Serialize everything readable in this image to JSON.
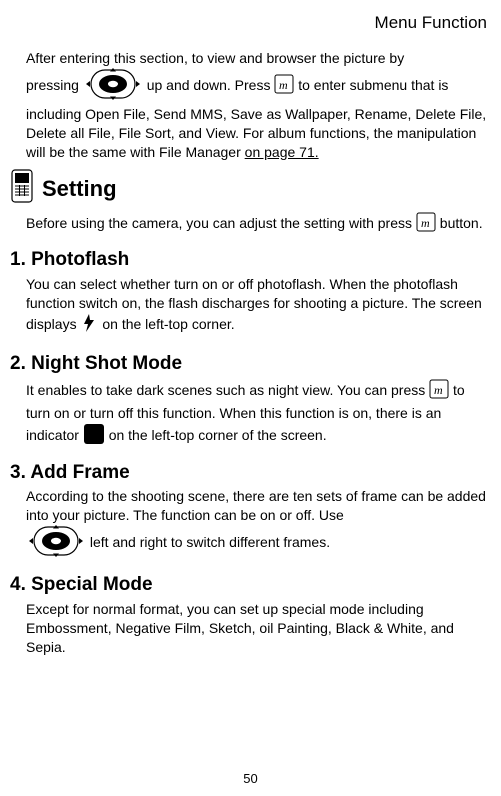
{
  "header": "Menu Function",
  "intro": {
    "t1": "After entering this section, to view and browser the picture by",
    "t2": "pressing ",
    "t3": " up and down.   Press ",
    "t4": " to enter submenu that is including Open File, Send MMS, Save as Wallpaper, Rename, Delete File, Delete all File, File Sort, and View.   For album functions, the manipulation will be the same with File Manager ",
    "link": "on page 71."
  },
  "setting": {
    "title": "Setting",
    "t1": "Before using the camera, you can adjust the setting with press ",
    "t2": " button."
  },
  "s1": {
    "title": "1. Photoflash",
    "t1": "You can select whether turn on or off photoflash.   When the photoflash function switch on, the flash discharges for shooting a picture.    The screen displays  ",
    "t2": "  on the left-top corner."
  },
  "s2": {
    "title": "2. Night Shot Mode",
    "t1": "It enables to take dark scenes such as night view.   You can press ",
    "t2": " to turn on or turn off this function.   When this function is on, there is an indicator ",
    "t3": " on the left-top corner of the screen."
  },
  "s3": {
    "title": "3. Add Frame",
    "t1": "According to the shooting scene, there are ten sets of frame can be added into your picture.   The function can be on or off. Use ",
    "t2": " left and right to switch different frames."
  },
  "s4": {
    "title": "4. Special Mode",
    "t1": "Except for normal format, you can set up special mode including Embossment, Negative Film, Sketch, oil Painting, Black & White, and Sepia."
  },
  "page": "50"
}
